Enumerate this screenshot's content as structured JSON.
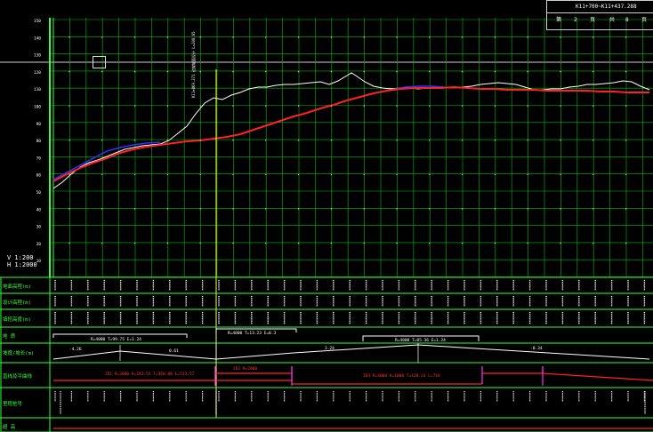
{
  "title_block": {
    "range": "K11+700~K11+437.288",
    "sheet_prefix": "第",
    "sheet_no": "2",
    "sheet_unit": "页",
    "total_prefix": "共",
    "total_no": "8",
    "total_unit": "页"
  },
  "scale": {
    "vertical": "V 1:200",
    "horizontal": "H 1:2000"
  },
  "y_ticks": [
    "150",
    "140",
    "130",
    "120",
    "110",
    "100",
    "90",
    "80",
    "70",
    "60",
    "50",
    "40",
    "30",
    "20",
    "10"
  ],
  "row_labels": {
    "ground_elev": "地面高程(m)",
    "design_elev": "设计高程(m)",
    "fill_cut": "填挖高度(m)",
    "geology": "地 质",
    "slope": "坡度/坡长(m)",
    "curve": "直线及平曲线",
    "chainage": "里程桩号",
    "misc": "超 高"
  },
  "vertical_curves": [
    "R=4000 T=99.75 E=1.24",
    "R=4800 T=13.23 E=0.3",
    "R=4000 T=85.36 E=1.24"
  ],
  "slope_labels": [
    "-4.26",
    "0.61",
    "3.24",
    "-0.34"
  ],
  "curve_labels": [
    "JD1 R=3000 A=283.55 T=368.88 L=723.57",
    "JD2 R=2000",
    "JD3 R=4000 A=1000 T=428.23 L=718"
  ],
  "marker_label": "K11+869.271 边坡坡面设计 L=208.65",
  "colors": {
    "grid": "#00bb00",
    "axis": "#33ff33",
    "ground_line": "#ffffff",
    "design_line": "#ff2222",
    "blue_line": "#3333ff",
    "marker": "#ffff66",
    "magenta": "#ff33ff"
  }
}
